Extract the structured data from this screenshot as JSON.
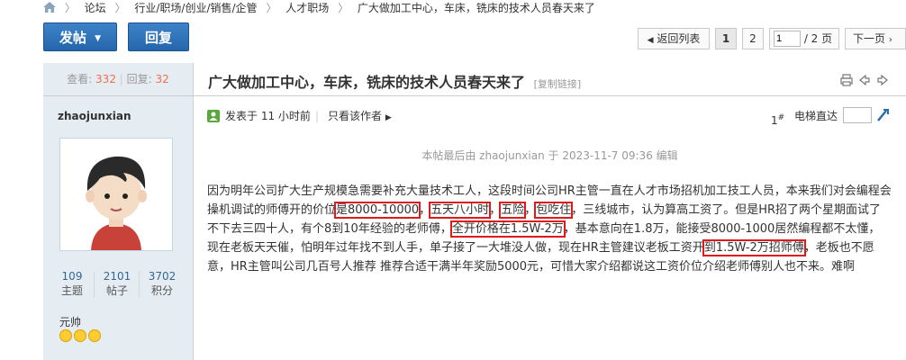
{
  "breadcrumb": {
    "items": [
      "论坛",
      "行业/职场/创业/销售/企管",
      "人才职场",
      "广大做加工中心，车床，铣床的技术人员春天来了"
    ]
  },
  "toolbar": {
    "post_label": "发帖",
    "reply_label": "回复",
    "back_list_label": "返回列表",
    "page_1": "1",
    "page_2": "2",
    "page_input_value": "1",
    "page_total": "/ 2 页",
    "next_page_label": "下一页"
  },
  "thread": {
    "views_label": "查看:",
    "views": "332",
    "replies_label": "回复:",
    "replies": "32",
    "title": "广大做加工中心，车床，铣床的技术人员春天来了",
    "copy_link": "[复制链接]"
  },
  "author": {
    "name": "zhaojunxian",
    "topics": "109",
    "topics_label": "主题",
    "posts": "2101",
    "posts_label": "帖子",
    "points": "3702",
    "points_label": "积分",
    "rank": "元帅"
  },
  "post": {
    "posted_time": "发表于 11 小时前",
    "only_author": "只看该作者",
    "floor": "1",
    "floor_suffix": "#",
    "jump_label": "电梯直达",
    "edited_note": "本帖最后由 zhaojunxian 于 2023-11-7 09:36 编辑",
    "body": {
      "t1": "因为明年公司扩大生产规模急需要补充大量技术工人，这段时间公司HR主管一直在人才市场招机加工技工人员，本来我们对会编程会操机调试的师傅开的价位",
      "h1": "是8000-10000",
      "t2": "，",
      "h2": "五天八小时",
      "t3": "，",
      "h3": "五险",
      "t4": "，",
      "h4": "包吃住",
      "t5": "，三线城市，认为算高工资了。但是HR招了两个星期面试了不下去三四十人，有个8到10年经验的老师傅，",
      "h5": "全开价格在1.5W-2万",
      "t6": "，基本意向在1.8万，能接受8000-1000居然编程都不太懂，现在老板天天催，怕明年过年找不到人手，单子接了一大堆没人做，现在HR主管建议老板工资开",
      "h6": "到1.5W-2万招师傅",
      "t7": "，老板也不愿意，HR主管叫公司几百号人推荐 推荐合适干满半年奖励5000元，可惜大家介绍都说这工资价位介绍老师傅别人也不来。难啊"
    }
  },
  "colors": {
    "primary_blue": "#2566ab",
    "sidebar_bg": "#e5edf2",
    "highlight_red": "#e0191b",
    "stat_orange": "#f26c4f"
  }
}
